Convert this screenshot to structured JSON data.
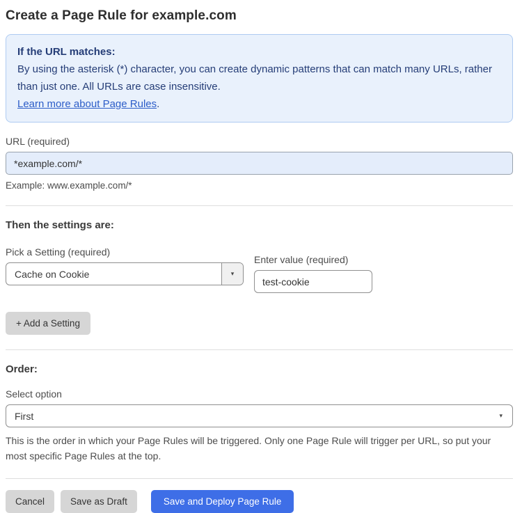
{
  "page": {
    "title": "Create a Page Rule for example.com"
  },
  "callout": {
    "heading": "If the URL matches:",
    "body": "By using the asterisk (*) character, you can create dynamic patterns that can match many URLs, rather than just one. All URLs are case insensitive.",
    "link_label": "Learn more about Page Rules",
    "link_suffix": "."
  },
  "url_field": {
    "label": "URL (required)",
    "value": "*example.com/*",
    "helper": "Example: www.example.com/*"
  },
  "settings_section": {
    "heading": "Then the settings are:",
    "setting_label": "Pick a Setting (required)",
    "setting_value": "Cache on Cookie",
    "value_label": "Enter value (required)",
    "value_value": "test-cookie",
    "add_button_label": "+ Add a Setting"
  },
  "order_section": {
    "heading": "Order:",
    "select_label": "Select option",
    "selected_option": "First",
    "helper": "This is the order in which your Page Rules will be triggered. Only one Page Rule will trigger per URL, so put your most specific Page Rules at the top."
  },
  "actions": {
    "cancel_label": "Cancel",
    "save_draft_label": "Save as Draft",
    "save_deploy_label": "Save and Deploy Page Rule"
  },
  "icons": {
    "dropdown_caret": "▾"
  },
  "colors": {
    "accent_blue": "#3e6ee7",
    "callout_bg": "#e9f1fc",
    "callout_border": "#aecbf2",
    "callout_text": "#253d77",
    "link_blue": "#2c5dc8",
    "highlighted_input_bg": "#e4edfb"
  }
}
